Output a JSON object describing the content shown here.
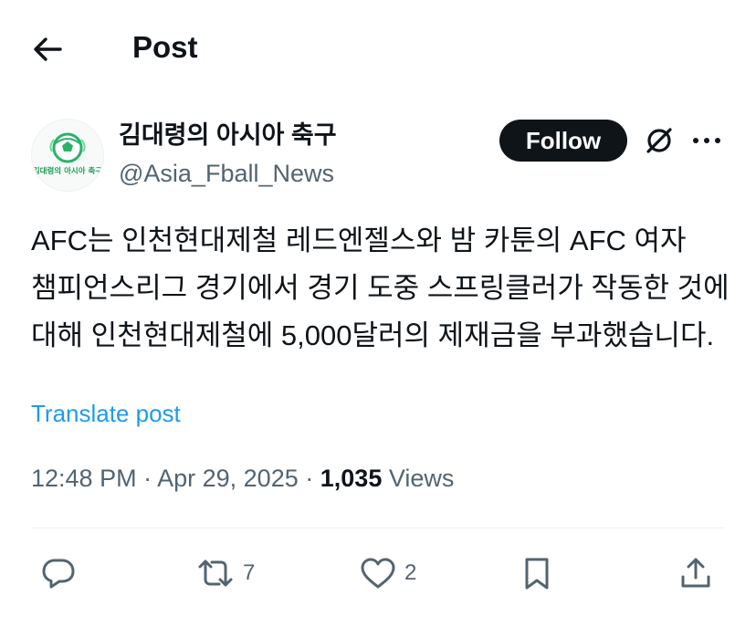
{
  "header": {
    "title": "Post",
    "back_icon": "arrow-left-icon"
  },
  "author": {
    "display_name": "김대령의 아시아 축구",
    "handle": "@Asia_Fball_News",
    "avatar_caption": "김대령의 아시아 축구",
    "follow_label": "Follow",
    "grok_icon": "grok-icon",
    "more_icon": "more-horizontal-icon"
  },
  "post": {
    "text": "AFC는 인천현대제철 레드엔젤스와 밤 카툰의 AFC 여자 챔피언스리그 경기에서 경기 도중 스프링클러가 작동한 것에 대해 인천현대제철에 5,000달러의 제재금을 부과했습니다.",
    "translate_label": "Translate post",
    "time": "12:48 PM",
    "separator": "·",
    "date": "Apr 29, 2025",
    "views_count": "1,035",
    "views_label": "Views"
  },
  "actions": {
    "reply_count": "",
    "repost_count": "7",
    "like_count": "2"
  },
  "colors": {
    "text_primary": "#0f1419",
    "text_secondary": "#536471",
    "link": "#1d9bf0",
    "follow_bg": "#0f1419",
    "avatar_green": "#2ecc71"
  }
}
